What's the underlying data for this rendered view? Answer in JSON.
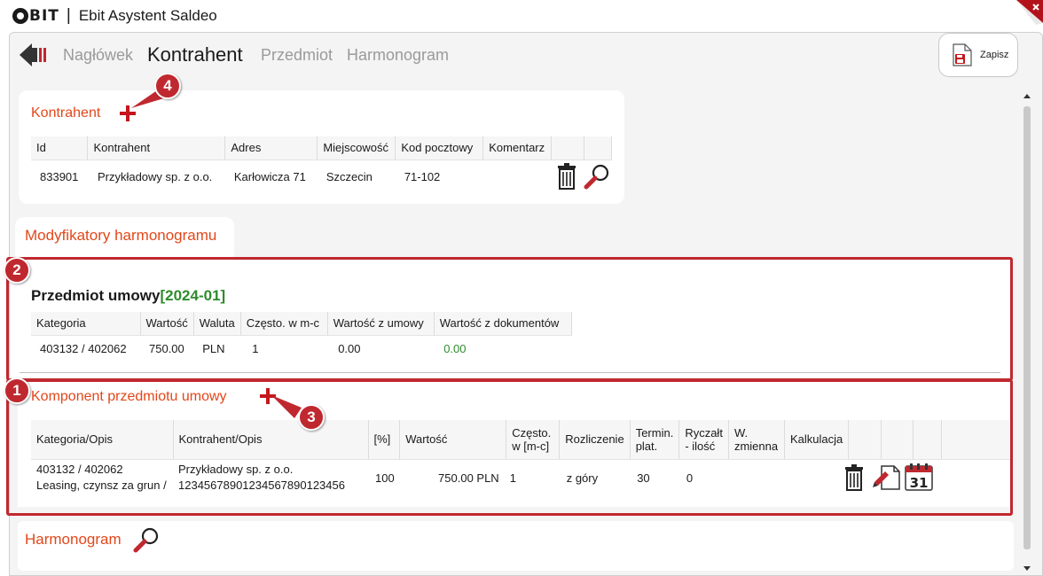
{
  "app": {
    "logo_text": "BIT",
    "separator": "|",
    "title": "Ebit Asystent Saldeo"
  },
  "nav": {
    "tabs": [
      {
        "label": "Nagłówek",
        "active": false
      },
      {
        "label": "Kontrahent",
        "active": true
      },
      {
        "label": "Przedmiot",
        "active": false
      },
      {
        "label": "Harmonogram",
        "active": false
      }
    ]
  },
  "toolbar": {
    "save_label": "Zapisz"
  },
  "kontrahent": {
    "title": "Kontrahent",
    "columns": [
      "Id",
      "Kontrahent",
      "Adres",
      "Miejscowość",
      "Kod pocztowy",
      "Komentarz"
    ],
    "rows": [
      {
        "id": "833901",
        "name": "Przykładowy sp. z o.o.",
        "address": "Karłowicza 71",
        "city": "Szczecin",
        "postal": "71-102",
        "comment": ""
      }
    ]
  },
  "modifiers": {
    "title": "Modyfikatory harmonogramu"
  },
  "przedmiot": {
    "title": "Przedmiot umowy",
    "period": "[2024-01]",
    "columns": [
      "Kategoria",
      "Wartość",
      "Waluta",
      "Często. w m-c",
      "Wartość z umowy",
      "Wartość z dokumentów"
    ],
    "rows": [
      {
        "category": "403132 / 402062",
        "value": "750.00",
        "currency": "PLN",
        "freq": "1",
        "contract_value": "0.00",
        "doc_value": "0.00"
      }
    ]
  },
  "komponent": {
    "title": "Komponent przedmiotu umowy",
    "columns": [
      "Kategoria/Opis",
      "Kontrahent/Opis",
      "[%]",
      "Wartość",
      "Często. w [m-c]",
      "Rozliczenie",
      "Termin. plat.",
      "Ryczałt - ilość",
      "W. zmienna",
      "Kalkulacja"
    ],
    "rows": [
      {
        "category_line1": "403132 / 402062",
        "category_line2": "Leasing, czynsz za grun /",
        "contractor_line1": "Przykładowy sp. z o.o.",
        "contractor_line2": "12345678901234567890123456",
        "percent": "100",
        "value": "750.00 PLN",
        "freq": "1",
        "settlement": "z góry",
        "term": "30",
        "lump": "0",
        "variable": "",
        "calc": ""
      }
    ]
  },
  "harmonogram": {
    "title": "Harmonogram"
  },
  "calendar_day": "31",
  "annotations": [
    "1",
    "2",
    "3",
    "4"
  ],
  "colors": {
    "accent": "#e2471a",
    "marker": "#c0282f",
    "green": "#2e8b2e"
  }
}
